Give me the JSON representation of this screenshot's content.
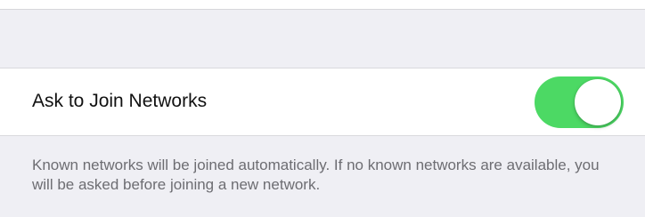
{
  "settings": {
    "ask_to_join": {
      "label": "Ask to Join Networks",
      "enabled": true,
      "toggle_color": "#4cd964"
    },
    "footer_text": "Known networks will be joined automatically. If no known networks are available, you will be asked before joining a new network."
  }
}
